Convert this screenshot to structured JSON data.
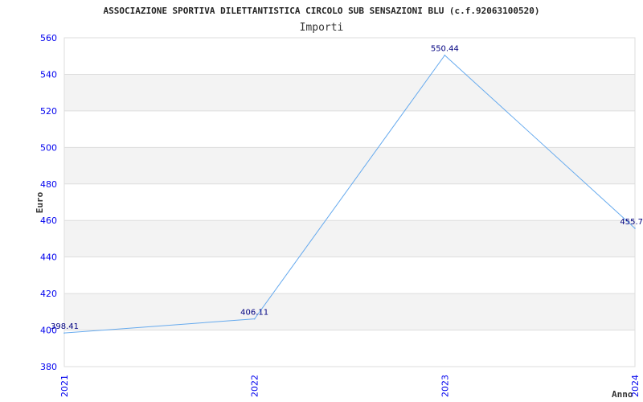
{
  "chart_data": {
    "type": "line",
    "title": "ASSOCIAZIONE SPORTIVA DILETTANTISTICA CIRCOLO SUB SENSAZIONI BLU (c.f.92063100520)",
    "subtitle": "Importi",
    "xlabel": "Anno",
    "ylabel": "Euro",
    "categories": [
      "2021",
      "2022",
      "2023",
      "2024"
    ],
    "values": [
      398.41,
      406.11,
      550.44,
      455.7
    ],
    "data_labels": [
      "398.41",
      "406.11",
      "550.44",
      "455.7"
    ],
    "ylim": [
      380,
      560
    ],
    "yticks": [
      380,
      400,
      420,
      440,
      460,
      480,
      500,
      520,
      540,
      560
    ],
    "grid": true,
    "legend": "none",
    "colors": {
      "line": "#66aaee",
      "band": "#f3f3f3",
      "grid": "#dddddd",
      "tick_text": "#0000ee",
      "label_text": "#000080"
    }
  }
}
